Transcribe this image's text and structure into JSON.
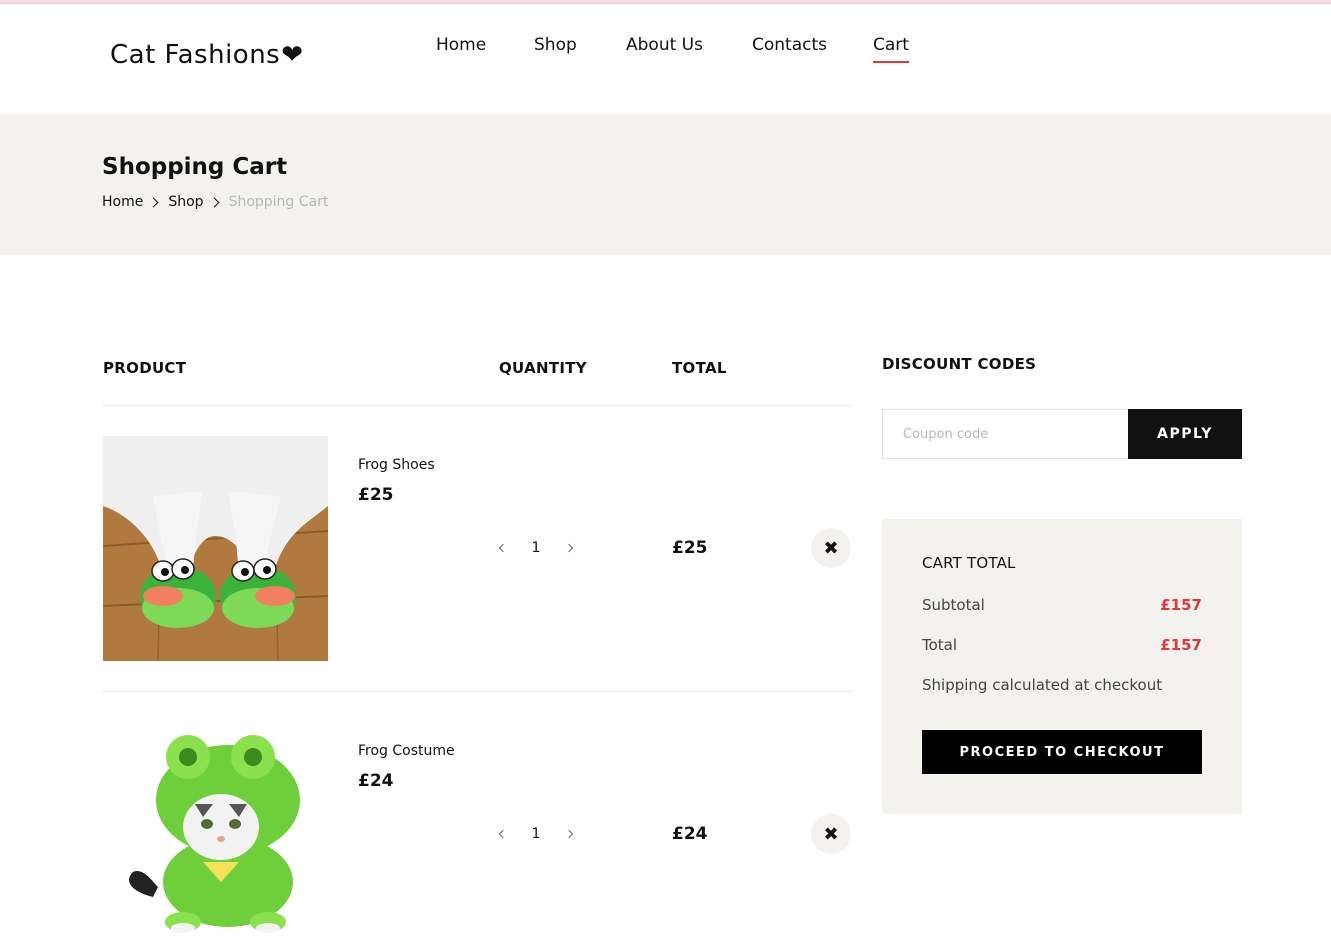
{
  "brand": {
    "name": "Cat Fashions",
    "heart": "❤"
  },
  "nav": {
    "items": [
      {
        "label": "Home",
        "active": false
      },
      {
        "label": "Shop",
        "active": false
      },
      {
        "label": "About Us",
        "active": false
      },
      {
        "label": "Contacts",
        "active": false
      },
      {
        "label": "Cart",
        "active": true
      }
    ]
  },
  "page": {
    "title": "Shopping Cart",
    "breadcrumb": [
      "Home",
      "Shop",
      "Shopping Cart"
    ]
  },
  "cart": {
    "headers": {
      "product": "PRODUCT",
      "quantity": "QUANTITY",
      "total": "TOTAL"
    },
    "items": [
      {
        "name": "Frog Shoes",
        "price": "£25",
        "quantity": "1",
        "total": "£25",
        "remove_icon": "✖"
      },
      {
        "name": "Frog Costume",
        "price": "£24",
        "quantity": "1",
        "total": "£24",
        "remove_icon": "✖"
      }
    ]
  },
  "discount": {
    "title": "DISCOUNT CODES",
    "placeholder": "Coupon code",
    "apply_label": "APPLY"
  },
  "totals": {
    "title": "CART TOTAL",
    "subtotal_label": "Subtotal",
    "subtotal_value": "£157",
    "total_label": "Total",
    "total_value": "£157",
    "shipping_note": "Shipping calculated at checkout",
    "checkout_label": "PROCEED TO CHECKOUT"
  },
  "colors": {
    "accent": "#e53637",
    "band": "#f3f2ee",
    "button": "#111111"
  }
}
